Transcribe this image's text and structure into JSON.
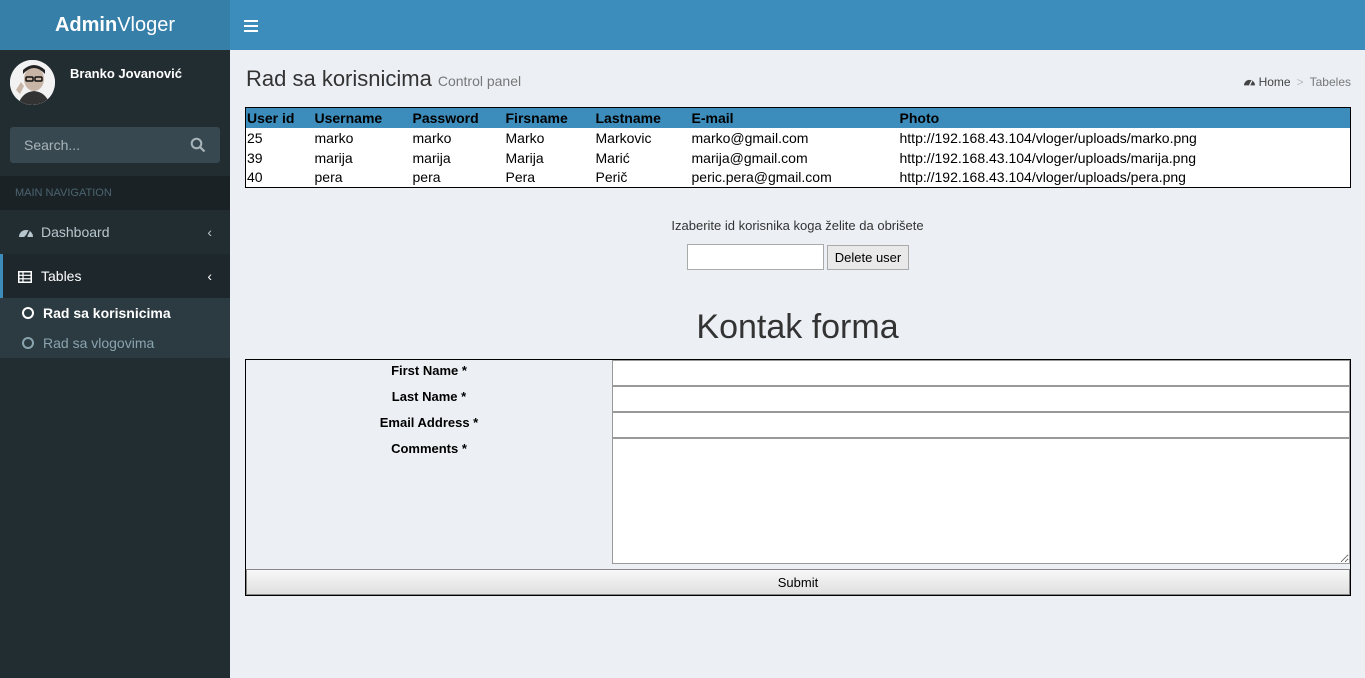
{
  "header": {
    "logo_bold": "Admin",
    "logo_light": "Vloger"
  },
  "sidebar": {
    "user_name": "Branko Jovanović",
    "search_placeholder": "Search...",
    "nav_header": "MAIN NAVIGATION",
    "items": [
      {
        "label": "Dashboard",
        "icon": "dashboard-icon"
      },
      {
        "label": "Tables",
        "icon": "table-icon",
        "active": true
      }
    ],
    "sub_items": [
      {
        "label": "Rad sa korisnicima",
        "active": true
      },
      {
        "label": "Rad sa vlogovima",
        "active": false
      }
    ]
  },
  "page": {
    "title": "Rad sa korisnicima",
    "subtitle": "Control panel",
    "breadcrumb_home": "Home",
    "breadcrumb_current": "Tabeles"
  },
  "users_table": {
    "headers": [
      "User id",
      "Username",
      "Password",
      "Firsname",
      "Lastname",
      "E-mail",
      "Photo"
    ],
    "rows": [
      [
        "25",
        "marko",
        "marko",
        "Marko",
        "Markovic",
        "marko@gmail.com",
        "http://192.168.43.104/vloger/uploads/marko.png"
      ],
      [
        "39",
        "marija",
        "marija",
        "Marija",
        "Marić",
        "marija@gmail.com",
        "http://192.168.43.104/vloger/uploads/marija.png"
      ],
      [
        "40",
        "pera",
        "pera",
        "Pera",
        "Perič",
        "peric.pera@gmail.com",
        "http://192.168.43.104/vloger/uploads/pera.png"
      ]
    ]
  },
  "delete": {
    "label": "Izaberite id korisnika koga želite da obrišete",
    "value": "",
    "button": "Delete user"
  },
  "contact_form": {
    "title": "Kontak forma",
    "first_name_label": "First Name *",
    "last_name_label": "Last Name *",
    "email_label": "Email Address *",
    "comments_label": "Comments *",
    "submit": "Submit"
  },
  "colors": {
    "header": "#3c8dbc",
    "logo_bg": "#367fa9",
    "sidebar": "#222d32",
    "content_bg": "#ecf0f5"
  }
}
